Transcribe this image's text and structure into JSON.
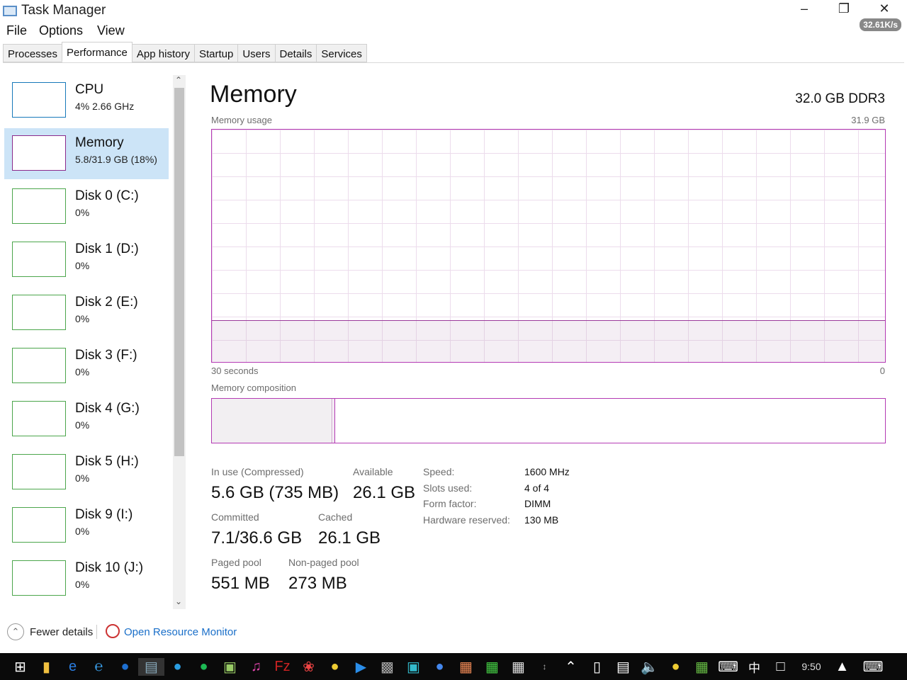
{
  "window": {
    "title": "Task Manager",
    "net_speed": "32.61K/s"
  },
  "menu": [
    "File",
    "Options",
    "View"
  ],
  "tabs": [
    "Processes",
    "Performance",
    "App history",
    "Startup",
    "Users",
    "Details",
    "Services"
  ],
  "sidebar": [
    {
      "name": "CPU",
      "value": "4%  2.66 GHz",
      "color": "#1779ba"
    },
    {
      "name": "Memory",
      "value": "5.8/31.9 GB (18%)",
      "color": "#8b2a8b"
    },
    {
      "name": "Disk 0 (C:)",
      "value": "0%",
      "color": "#4ca64c"
    },
    {
      "name": "Disk 1 (D:)",
      "value": "0%",
      "color": "#4ca64c"
    },
    {
      "name": "Disk 2 (E:)",
      "value": "0%",
      "color": "#4ca64c"
    },
    {
      "name": "Disk 3 (F:)",
      "value": "0%",
      "color": "#4ca64c"
    },
    {
      "name": "Disk 4 (G:)",
      "value": "0%",
      "color": "#4ca64c"
    },
    {
      "name": "Disk 5 (H:)",
      "value": "0%",
      "color": "#4ca64c"
    },
    {
      "name": "Disk 9 (I:)",
      "value": "0%",
      "color": "#4ca64c"
    },
    {
      "name": "Disk 10 (J:)",
      "value": "0%",
      "color": "#4ca64c"
    }
  ],
  "main": {
    "title": "Memory",
    "spec": "32.0 GB DDR3",
    "usage_label": "Memory usage",
    "usage_max": "31.9 GB",
    "time_label": "30 seconds",
    "time_end": "0",
    "composition_label": "Memory composition",
    "usage_fraction": 0.18,
    "stats": {
      "in_use_label": "In use (Compressed)",
      "in_use": "5.6 GB (735 MB)",
      "available_label": "Available",
      "available": "26.1 GB",
      "committed_label": "Committed",
      "committed": "7.1/36.6 GB",
      "cached_label": "Cached",
      "cached": "26.1 GB",
      "paged_label": "Paged pool",
      "paged": "551 MB",
      "nonpaged_label": "Non-paged pool",
      "nonpaged": "273 MB"
    },
    "details": [
      {
        "k": "Speed:",
        "v": "1600 MHz"
      },
      {
        "k": "Slots used:",
        "v": "4 of 4"
      },
      {
        "k": "Form factor:",
        "v": "DIMM"
      },
      {
        "k": "Hardware reserved:",
        "v": "130 MB"
      }
    ]
  },
  "footer": {
    "fewer": "Fewer details",
    "monitor": "Open Resource Monitor"
  },
  "taskbar": {
    "clock": "9:50"
  }
}
